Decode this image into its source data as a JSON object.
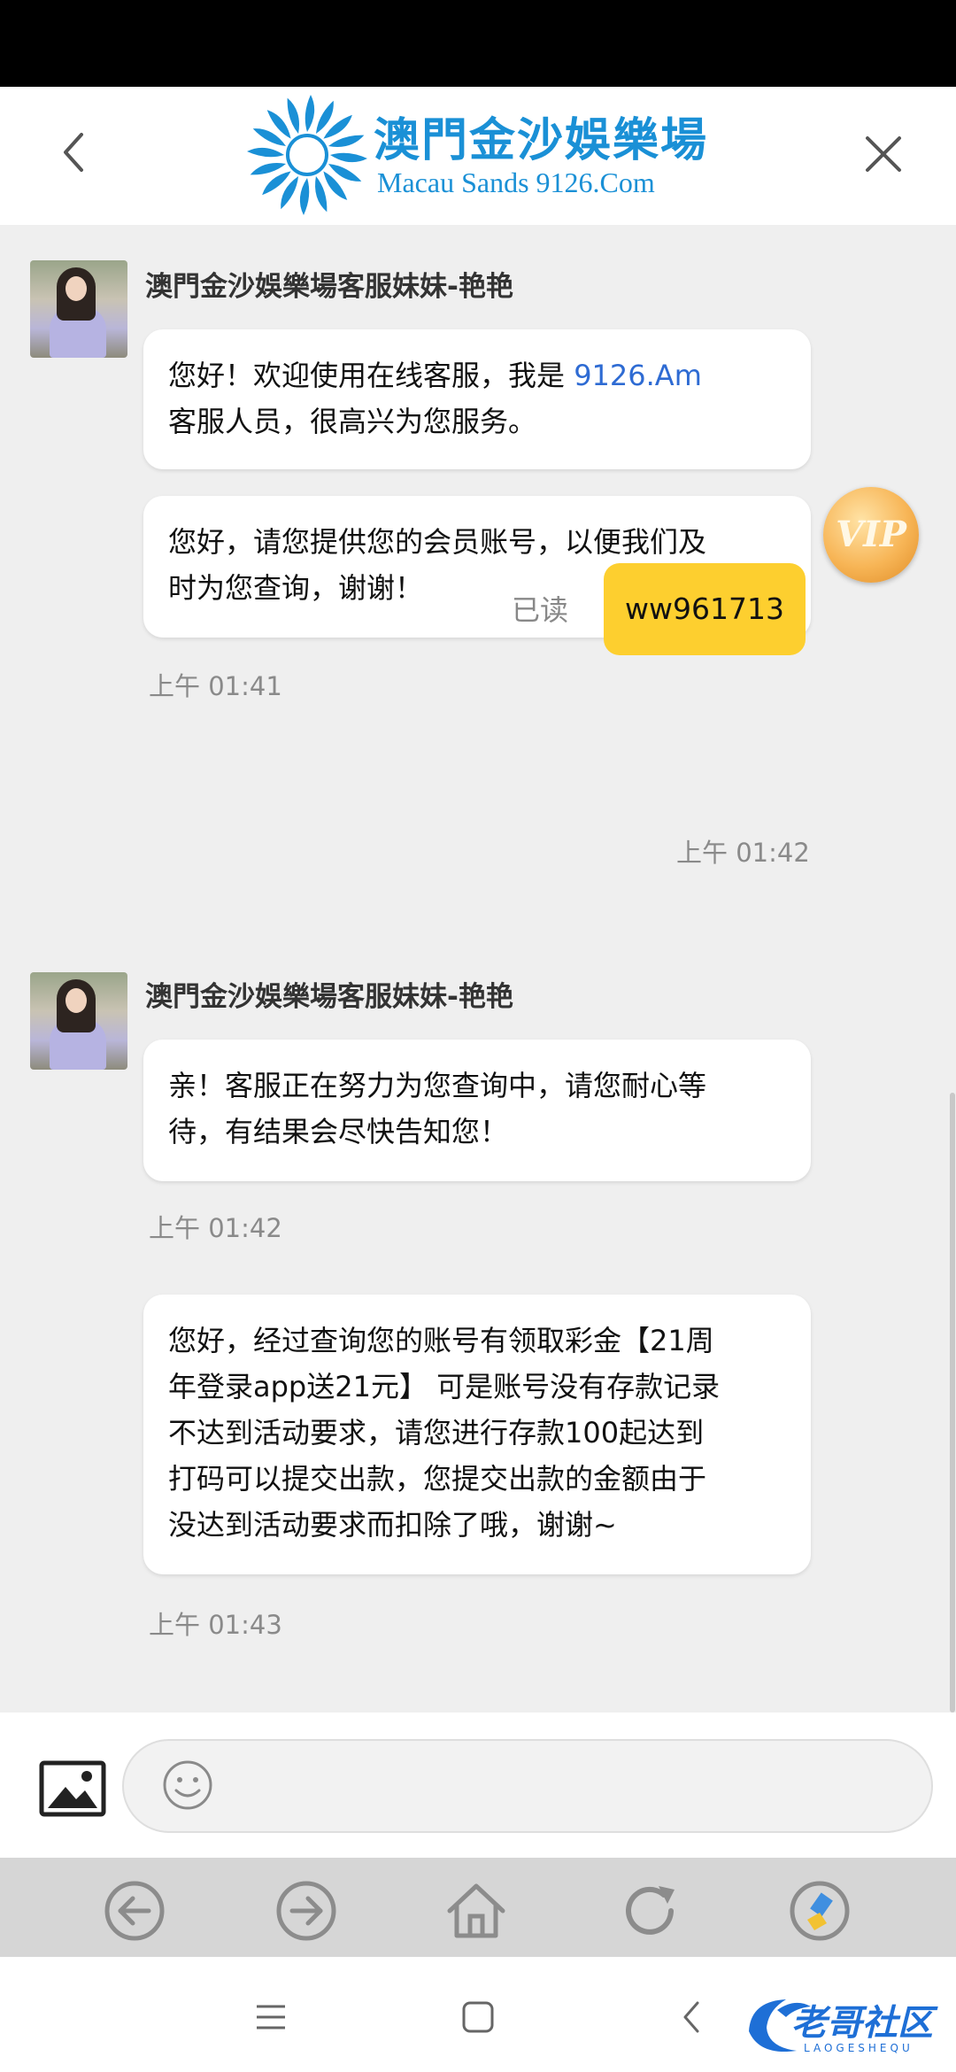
{
  "header": {
    "logo_title": "澳門金沙娛樂場",
    "logo_subtitle": "Macau Sands 9126.Com"
  },
  "chat": {
    "messages": [
      {
        "sender": "澳門金沙娛樂場客服妹妹-艳艳",
        "bubble1_line1_a": "您好！欢迎使用在线客服，我是 ",
        "bubble1_line1_link": "9126.Am",
        "bubble1_line2": "客服人员，很高兴为您服务。",
        "bubble2_line1": "您好，请您提供您的会员账号，以便我们及",
        "bubble2_line2": "时为您查询，谢谢！",
        "time": "上午 01:41"
      },
      {
        "read_status": "已读",
        "text": "ww961713",
        "badge": "VIP",
        "time": "上午 01:42"
      },
      {
        "sender": "澳門金沙娛樂場客服妹妹-艳艳",
        "bubble1_line1": "亲！客服正在努力为您查询中，请您耐心等",
        "bubble1_line2": "待，有结果会尽快告知您！",
        "time": "上午 01:42"
      },
      {
        "bubble_lines": [
          "您好，经过查询您的账号有领取彩金【21周",
          "年登录app送21元】 可是账号没有存款记录",
          "不达到活动要求，请您进行存款100起达到",
          "打码可以提交出款，您提交出款的金额由于",
          "没达到活动要求而扣除了哦，谢谢~"
        ],
        "time": "上午 01:43"
      }
    ]
  },
  "input": {
    "placeholder": ""
  },
  "toolbar_icons": [
    "back-circle-icon",
    "forward-circle-icon",
    "home-icon",
    "refresh-icon",
    "clean-icon"
  ],
  "nav_icons": [
    "menu-icon",
    "square-icon",
    "back-chevron-icon"
  ],
  "watermark": {
    "text": "老哥社区",
    "sub": "LAOGESHEQU"
  },
  "colors": {
    "accent_blue": "#1a90d6",
    "my_bubble": "#fdcf2f",
    "link": "#2e6bd3"
  }
}
